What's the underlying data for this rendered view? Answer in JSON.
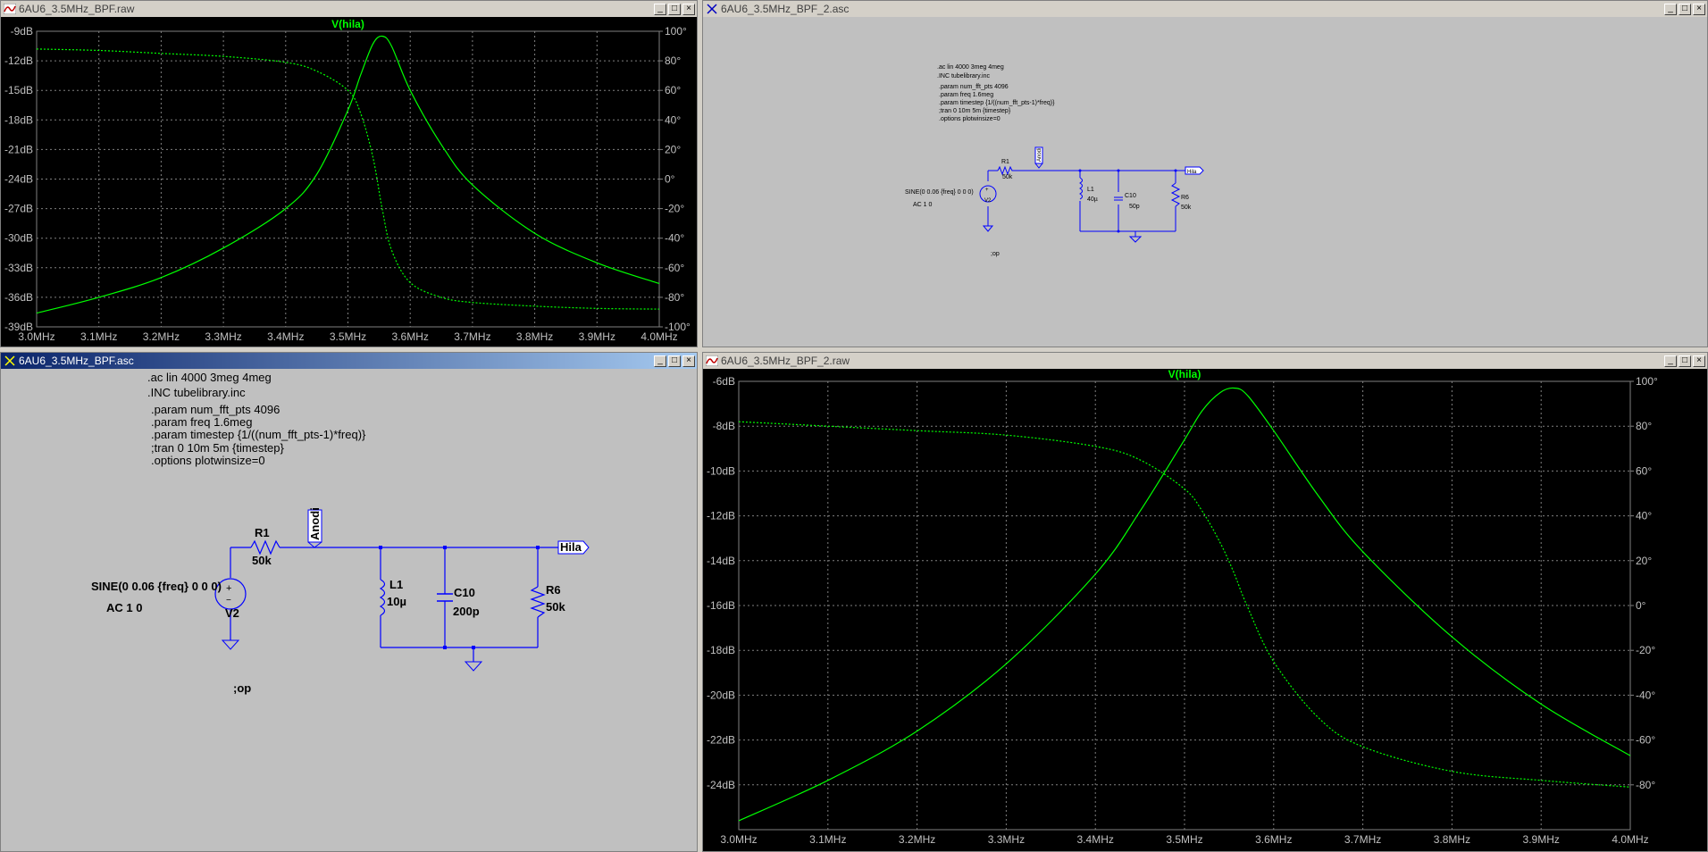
{
  "windows": {
    "plot1": {
      "title": "6AU6_3.5MHz_BPF.raw"
    },
    "sch1": {
      "title": "6AU6_3.5MHz_BPF_2.asc"
    },
    "sch2": {
      "title": "6AU6_3.5MHz_BPF.asc"
    },
    "plot2": {
      "title": "6AU6_3.5MHz_BPF_2.raw"
    }
  },
  "buttons": {
    "minimize": "_",
    "maximize": "□",
    "close": "×"
  },
  "colors": {
    "trace": "#00ff00",
    "wire": "#0000ff",
    "grid": "#808080",
    "titlebar_active": "#0a246a"
  },
  "chart_data": [
    {
      "type": "line",
      "title": "V(hila)",
      "xlabel": "",
      "ylabel": "",
      "xlim": [
        3.0,
        4.0
      ],
      "ylim": [
        -39,
        -9
      ],
      "y2lim": [
        -100,
        100
      ],
      "x_ticks": [
        "3.0MHz",
        "3.1MHz",
        "3.2MHz",
        "3.3MHz",
        "3.4MHz",
        "3.5MHz",
        "3.6MHz",
        "3.7MHz",
        "3.8MHz",
        "3.9MHz",
        "4.0MHz"
      ],
      "y_ticks": [
        "-9dB",
        "-12dB",
        "-15dB",
        "-18dB",
        "-21dB",
        "-24dB",
        "-27dB",
        "-30dB",
        "-33dB",
        "-36dB",
        "-39dB"
      ],
      "y2_ticks": [
        "100°",
        "80°",
        "60°",
        "40°",
        "20°",
        "0°",
        "-20°",
        "-40°",
        "-60°",
        "-80°",
        "-100°"
      ],
      "grid": true,
      "series": [
        {
          "style": "solid",
          "x": [
            3.0,
            3.1,
            3.2,
            3.3,
            3.4,
            3.45,
            3.5,
            3.52,
            3.54,
            3.555,
            3.57,
            3.6,
            3.65,
            3.7,
            3.8,
            3.9,
            4.0
          ],
          "values": [
            -37.6,
            -36,
            -34,
            -31,
            -27,
            -23.5,
            -17,
            -13.5,
            -10.3,
            -9.5,
            -10.5,
            -15,
            -20.5,
            -24.6,
            -29.5,
            -32.5,
            -34.6
          ]
        },
        {
          "style": "dashed",
          "axis": "y2",
          "x": [
            3.0,
            3.1,
            3.2,
            3.3,
            3.4,
            3.45,
            3.5,
            3.52,
            3.54,
            3.555,
            3.57,
            3.6,
            3.65,
            3.7,
            3.8,
            3.9,
            4.0
          ],
          "values": [
            88,
            87,
            85,
            83,
            79,
            73,
            60,
            45,
            15,
            -20,
            -48,
            -70,
            -80,
            -83.5,
            -86,
            -87.5,
            -88
          ]
        }
      ]
    },
    {
      "type": "line",
      "title": "V(hila)",
      "xlabel": "",
      "ylabel": "",
      "xlim": [
        3.0,
        4.0
      ],
      "ylim": [
        -26,
        -6
      ],
      "y2lim": [
        -100,
        100
      ],
      "x_ticks": [
        "3.0MHz",
        "3.1MHz",
        "3.2MHz",
        "3.3MHz",
        "3.4MHz",
        "3.5MHz",
        "3.6MHz",
        "3.7MHz",
        "3.8MHz",
        "3.9MHz",
        "4.0MHz"
      ],
      "y_ticks": [
        "-6dB",
        "-8dB",
        "-10dB",
        "-12dB",
        "-14dB",
        "-16dB",
        "-18dB",
        "-20dB",
        "-22dB",
        "-24dB"
      ],
      "y2_ticks": [
        "100°",
        "80°",
        "60°",
        "40°",
        "20°",
        "0°",
        "-20°",
        "-40°",
        "-60°",
        "-80°"
      ],
      "grid": true,
      "series": [
        {
          "style": "solid",
          "x": [
            3.0,
            3.1,
            3.2,
            3.3,
            3.4,
            3.45,
            3.5,
            3.52,
            3.54,
            3.555,
            3.57,
            3.6,
            3.65,
            3.7,
            3.8,
            3.9,
            4.0
          ],
          "values": [
            -25.6,
            -23.8,
            -21.6,
            -18.6,
            -14.6,
            -11.8,
            -8.6,
            -7.3,
            -6.5,
            -6.3,
            -6.6,
            -8.2,
            -11.1,
            -13.6,
            -17.4,
            -20.4,
            -22.7
          ]
        },
        {
          "style": "dashed",
          "axis": "y2",
          "x": [
            3.0,
            3.1,
            3.2,
            3.3,
            3.4,
            3.45,
            3.5,
            3.52,
            3.54,
            3.555,
            3.57,
            3.6,
            3.65,
            3.7,
            3.8,
            3.9,
            4.0
          ],
          "values": [
            82,
            80,
            78,
            76,
            71,
            65,
            52,
            42,
            28,
            15,
            0,
            -25,
            -50,
            -63,
            -74,
            -78,
            -81
          ]
        }
      ]
    }
  ],
  "schematic_small": {
    "directives": [
      ".ac lin 4000 3meg 4meg",
      ".INC tubelibrary.inc"
    ],
    "params": [
      ".param num_fft_pts 4096",
      ".param freq 1.6meg",
      ".param timestep {1/((num_fft_pts-1)*freq)}",
      ";tran 0 10m 5m {timestep}",
      ".options plotwinsize=0"
    ],
    "source_spec": "SINE(0 0.06 {freq} 0 0 0)",
    "ac_spec": "AC 1 0",
    "op": ";op",
    "r1_name": "R1",
    "r1_value": "50k",
    "l1_name": "L1",
    "l1_value": "40µ",
    "c10_name": "C10",
    "c10_value": "50p",
    "r6_name": "R6",
    "r6_value": "50k",
    "v2_name": "V2",
    "anodi_label": "Anodi",
    "hila_label": "Hila"
  },
  "schematic_large": {
    "directives": [
      ".ac lin 4000 3meg 4meg",
      ".INC tubelibrary.inc"
    ],
    "params": [
      ".param num_fft_pts 4096",
      ".param freq 1.6meg",
      ".param timestep {1/((num_fft_pts-1)*freq)}",
      ";tran 0 10m 5m {timestep}",
      ".options plotwinsize=0"
    ],
    "source_spec": "SINE(0 0.06 {freq} 0 0 0)",
    "ac_spec": "AC 1 0",
    "op": ";op",
    "r1_name": "R1",
    "r1_value": "50k",
    "l1_name": "L1",
    "l1_value": "10µ",
    "c10_name": "C10",
    "c10_value": "200p",
    "r6_name": "R6",
    "r6_value": "50k",
    "v2_name": "V2",
    "anodi_label": "Anodi",
    "hila_label": "Hila"
  }
}
